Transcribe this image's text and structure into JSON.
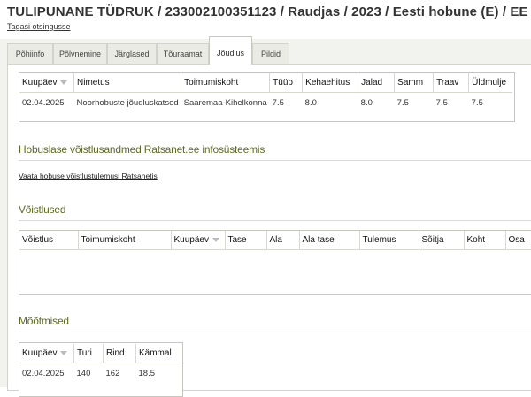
{
  "header": {
    "title": "TULIPUNANE TÜDRUK / 233002100351123 / Raudjas / 2023 / Eesti hobune (E) / EE",
    "back_link": "Tagasi otsingusse"
  },
  "tabs": [
    {
      "label": "Põhiinfo"
    },
    {
      "label": "Põlvnemine"
    },
    {
      "label": "Järglased"
    },
    {
      "label": "Tõuraamat"
    },
    {
      "label": "Jõudlus",
      "active": true
    },
    {
      "label": "Pildid"
    }
  ],
  "performance_table": {
    "headers": [
      "Kuupäev",
      "Nimetus",
      "Toimumiskoht",
      "Tüüp",
      "Kehaehitus",
      "Jalad",
      "Samm",
      "Traav",
      "Üldmulje"
    ],
    "rows": [
      [
        "02.04.2025",
        "Noorhobuste jõudluskatsed",
        "Saaremaa-Kihelkonna",
        "7.5",
        "8.0",
        "8.0",
        "7.5",
        "7.5",
        "7.5"
      ]
    ]
  },
  "ratsanet": {
    "title": "Hobuslase võistlusandmed Ratsanet.ee infosüsteemis",
    "link": "Vaata hobuse võistlustulemusi Ratsanetis"
  },
  "competitions": {
    "title": "Võistlused",
    "headers": [
      "Võistlus",
      "Toimumiskoht",
      "Kuupäev",
      "Tase",
      "Ala",
      "Ala tase",
      "Tulemus",
      "Sõitja",
      "Koht",
      "Osa"
    ]
  },
  "measurements": {
    "title": "Mõõtmised",
    "headers": [
      "Kuupäev",
      "Turi",
      "Rind",
      "Kämmal"
    ],
    "rows": [
      [
        "02.04.2025",
        "140",
        "162",
        "18.5"
      ]
    ]
  },
  "colors": {
    "section_title": "#5e6a25",
    "tab_bar": "#f2f2ee"
  }
}
